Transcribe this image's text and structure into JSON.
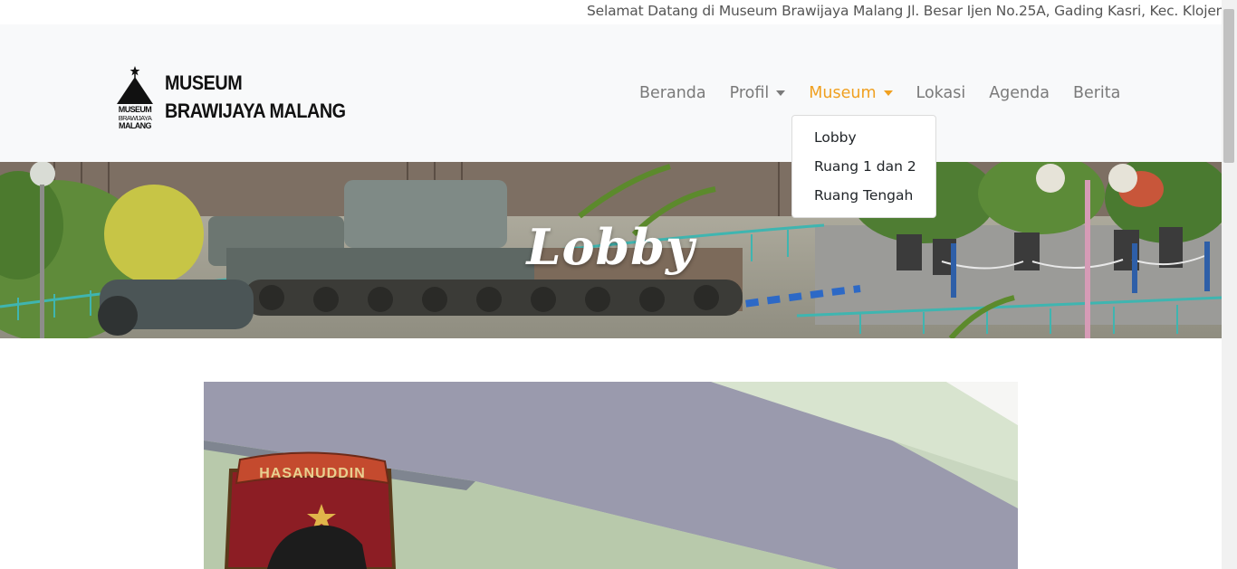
{
  "marquee": {
    "text": "Selamat Datang di Museum Brawijaya Malang Jl. Besar Ijen No.25A, Gading Kasri, Kec. Klojen, Kota M"
  },
  "brand": {
    "line1": "MUSEUM",
    "line2": "BRAWIJAYA MALANG",
    "logo_text": [
      "MUSEUM",
      "BRAWIJAYA",
      "MALANG"
    ],
    "logo_icon": "museum-logo-icon"
  },
  "nav": {
    "items": [
      {
        "label": "Beranda",
        "dropdown": false,
        "active": false
      },
      {
        "label": "Profil",
        "dropdown": true,
        "active": false
      },
      {
        "label": "Museum",
        "dropdown": true,
        "active": true
      },
      {
        "label": "Lokasi",
        "dropdown": false,
        "active": false
      },
      {
        "label": "Agenda",
        "dropdown": false,
        "active": false
      },
      {
        "label": "Berita",
        "dropdown": false,
        "active": false
      }
    ],
    "active_color": "#f0a020",
    "text_color": "#7a7a7a"
  },
  "dropdown": {
    "items": [
      "Lobby",
      "Ruang 1 dan 2",
      "Ruang Tengah"
    ]
  },
  "hero": {
    "title": "Lobby",
    "image": "museum-courtyard-tank-photo"
  },
  "content": {
    "image": "lobby-hasanuddin-emblem-photo",
    "emblem_text": "HASANUDDIN"
  }
}
